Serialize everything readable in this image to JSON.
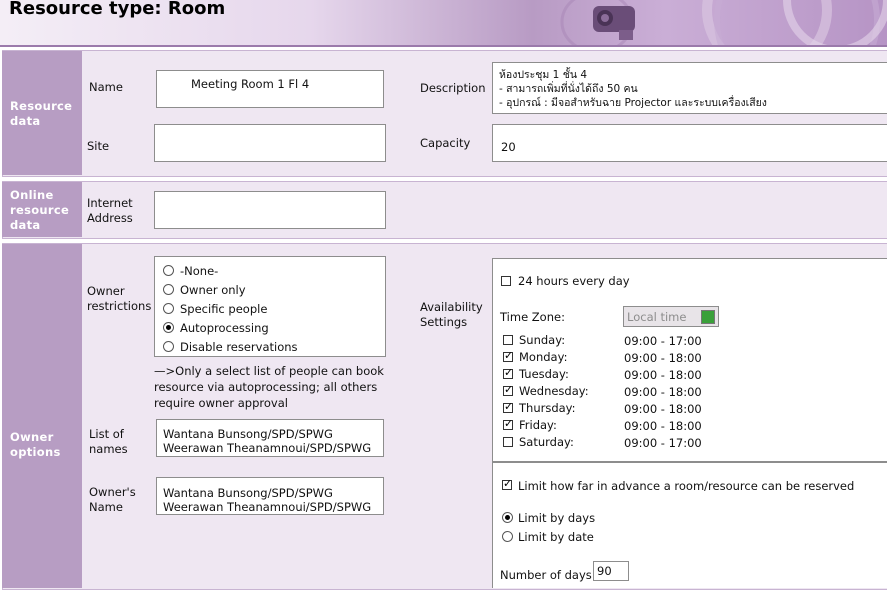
{
  "header": {
    "title": "Resource type: Room"
  },
  "sections": {
    "resource_data": "Resource data",
    "online_resource_data": "Online resource data",
    "owner_options": "Owner options"
  },
  "resource": {
    "name_label": "Name",
    "name_value": "Meeting Room 1 Fl 4",
    "site_label": "Site",
    "site_value": "",
    "description_label": "Description",
    "description_lines": [
      "ห้องประชุม 1 ชั้น 4",
      "- สามารถเพิ่มที่นั่งได้ถึง 50 คน",
      "- อุปกรณ์ :  มีจอสำหรับฉาย  Projector  และระบบเครื่องเสียง"
    ],
    "capacity_label": "Capacity",
    "capacity_value": "20"
  },
  "online": {
    "internet_address_label_1": "Internet",
    "internet_address_label_2": "Address",
    "internet_address_value": ""
  },
  "owner": {
    "restrictions_label_1": "Owner",
    "restrictions_label_2": "restrictions",
    "restriction_options": [
      "-None-",
      "Owner only",
      "Specific people",
      "Autoprocessing",
      "Disable reservations"
    ],
    "selected_restriction": "Autoprocessing",
    "note_lines": [
      "—>Only a select list of people can book",
      "resource via autoprocessing; all others",
      "require owner approval"
    ],
    "list_of_names_label_1": "List of",
    "list_of_names_label_2": "names",
    "list_of_names": [
      "Wantana Bunsong/SPD/SPWG",
      "Weerawan Theanamnoui/SPD/SPWG"
    ],
    "owners_name_label_1": "Owner's",
    "owners_name_label_2": "Name",
    "owners_names": [
      "Wantana Bunsong/SPD/SPWG",
      "Weerawan Theanamnoui/SPD/SPWG"
    ]
  },
  "availability": {
    "label_1": "Availability",
    "label_2": "Settings",
    "all_day_label": "24 hours every day",
    "all_day_checked": false,
    "time_zone_label": "Time Zone:",
    "time_zone_value": "Local time",
    "days": [
      {
        "name": "Sunday:",
        "checked": false,
        "hours": "09:00 - 17:00"
      },
      {
        "name": "Monday:",
        "checked": true,
        "hours": "09:00 - 18:00"
      },
      {
        "name": "Tuesday:",
        "checked": true,
        "hours": "09:00 - 18:00"
      },
      {
        "name": "Wednesday:",
        "checked": true,
        "hours": "09:00 - 18:00"
      },
      {
        "name": "Thursday:",
        "checked": true,
        "hours": "09:00 - 18:00"
      },
      {
        "name": "Friday:",
        "checked": true,
        "hours": "09:00 - 18:00"
      },
      {
        "name": "Saturday:",
        "checked": false,
        "hours": "09:00 - 17:00"
      }
    ],
    "limit_advance_label": "Limit how far in advance a room/resource can be reserved",
    "limit_advance_checked": true,
    "limit_options": [
      "Limit by days",
      "Limit by date"
    ],
    "selected_limit": "Limit by days",
    "number_of_days_label": "Number of days:",
    "number_of_days_value": "90"
  }
}
